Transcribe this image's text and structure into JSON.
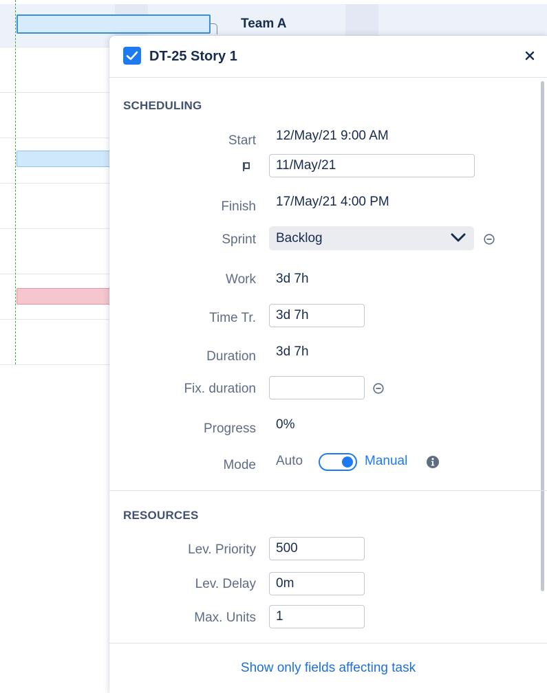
{
  "gantt": {
    "row_header": "Team A"
  },
  "panel": {
    "title": "DT-25 Story 1",
    "icons": {
      "checkbox": "checkbox-checked-icon",
      "close": "close-icon",
      "pin": "constraint-pin-icon",
      "remove": "remove-circle-icon",
      "chevron": "chevron-down-icon",
      "info": "info-icon"
    },
    "scheduling": {
      "section_title": "SCHEDULING",
      "start_label": "Start",
      "start_value": "12/May/21 9:00 AM",
      "constraint_value": "11/May/21",
      "finish_label": "Finish",
      "finish_value": "17/May/21 4:00 PM",
      "sprint_label": "Sprint",
      "sprint_value": "Backlog",
      "work_label": "Work",
      "work_value": "3d 7h",
      "time_tracking_label": "Time Tr.",
      "time_tracking_value": "3d 7h",
      "duration_label": "Duration",
      "duration_value": "3d 7h",
      "fix_duration_label": "Fix. duration",
      "fix_duration_value": "",
      "progress_label": "Progress",
      "progress_value": "0%",
      "mode_label": "Mode",
      "mode_auto": "Auto",
      "mode_manual": "Manual",
      "mode_is_manual": true
    },
    "resources": {
      "section_title": "RESOURCES",
      "lev_priority_label": "Lev. Priority",
      "lev_priority_value": "500",
      "lev_delay_label": "Lev. Delay",
      "lev_delay_value": "0m",
      "max_units_label": "Max. Units",
      "max_units_value": "1"
    },
    "footer_link": "Show only fields affecting task"
  },
  "colors": {
    "accent": "#1d7af2",
    "link": "#1d6fd6",
    "today_line": "#3aa845",
    "bar_blue": "#cfe8fb",
    "bar_red": "#f6c6cf"
  }
}
